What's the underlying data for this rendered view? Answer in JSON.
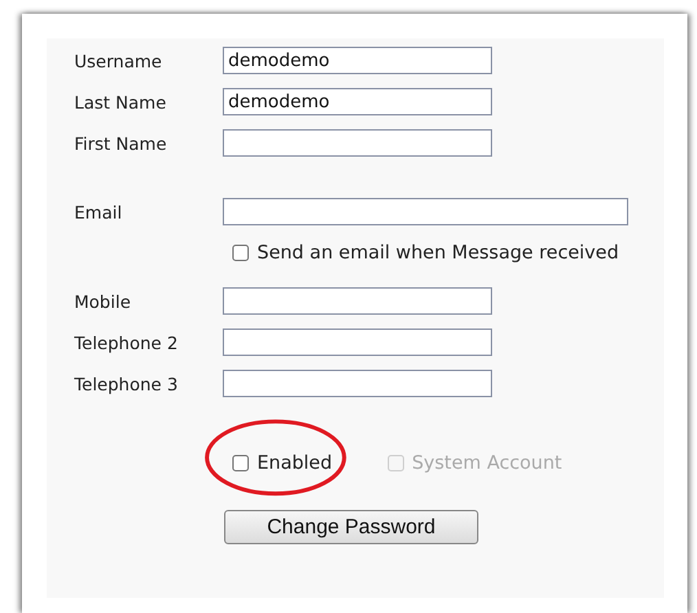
{
  "fields_top": [
    {
      "label": "Username",
      "value": "demodemo"
    },
    {
      "label": "Last Name",
      "value": "demodemo"
    },
    {
      "label": "First Name"
    }
  ],
  "email": {
    "label": "Email",
    "notify": {
      "label": "Send an email when Message received",
      "checked": false
    }
  },
  "fields_phone": [
    {
      "label": "Mobile"
    },
    {
      "label": "Telephone 2"
    },
    {
      "label": "Telephone 3"
    }
  ],
  "options": [
    {
      "label": "Enabled",
      "checked": false,
      "disabled": false,
      "highlighted": true
    },
    {
      "label": "System Account",
      "checked": false,
      "disabled": true,
      "highlighted": false
    }
  ],
  "button": "Change Password"
}
